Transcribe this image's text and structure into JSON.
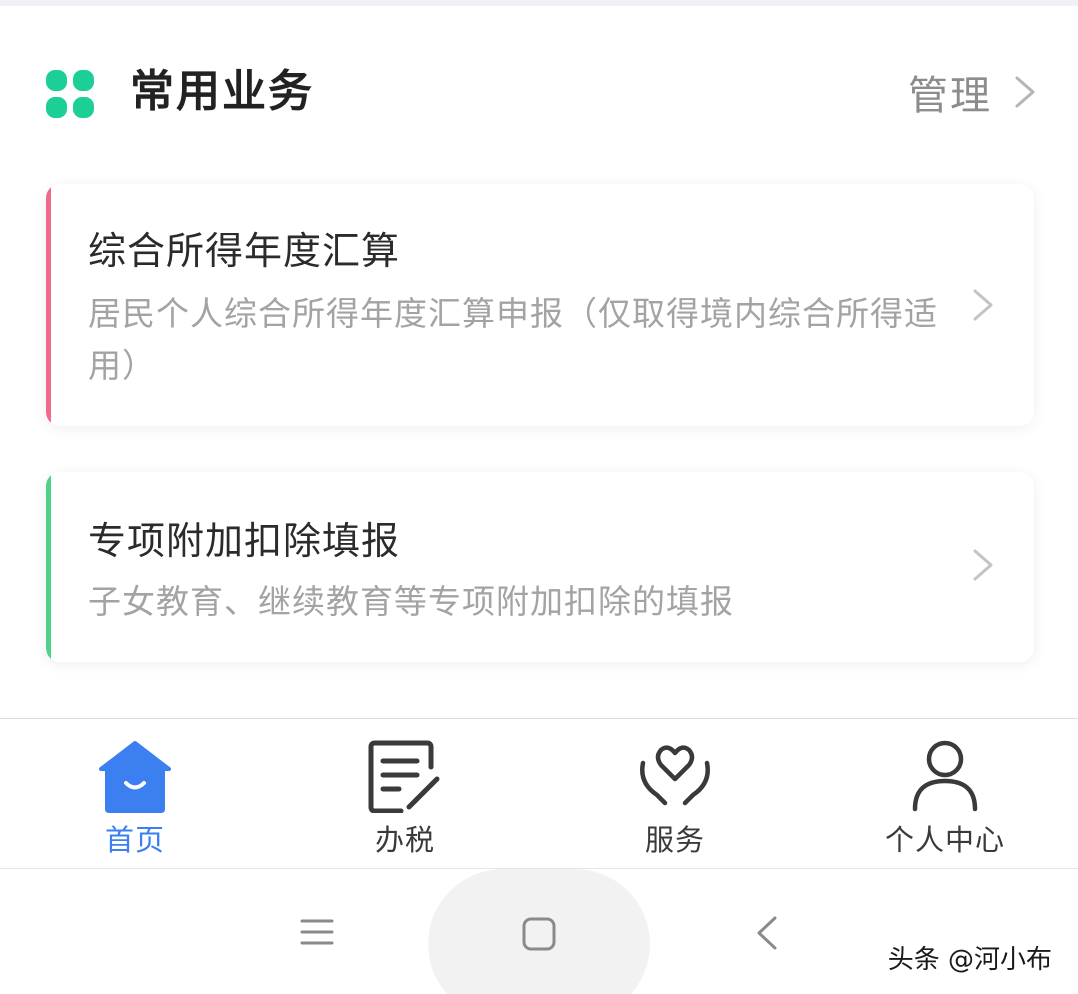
{
  "section": {
    "title": "常用业务",
    "manage_label": "管理",
    "icon": "four-dots-icon",
    "icon_color": "#1ccf97"
  },
  "cards": [
    {
      "title": "综合所得年度汇算",
      "description": "居民个人综合所得年度汇算申报（仅取得境内综合所得适用）",
      "accent_color": "#f06a8e"
    },
    {
      "title": "专项附加扣除填报",
      "description": "子女教育、继续教育等专项附加扣除的填报",
      "accent_color": "#4fd18a"
    }
  ],
  "tabbar": {
    "active_color": "#3b7ff0",
    "items": [
      {
        "label": "首页",
        "icon": "home-icon",
        "active": true
      },
      {
        "label": "办税",
        "icon": "tax-form-icon",
        "active": false
      },
      {
        "label": "服务",
        "icon": "heart-hands-icon",
        "active": false
      },
      {
        "label": "个人中心",
        "icon": "person-icon",
        "active": false
      }
    ]
  },
  "system_nav": {
    "buttons": [
      "menu-icon",
      "home-square-icon",
      "back-icon"
    ],
    "watermark": "头条 @河小布"
  }
}
